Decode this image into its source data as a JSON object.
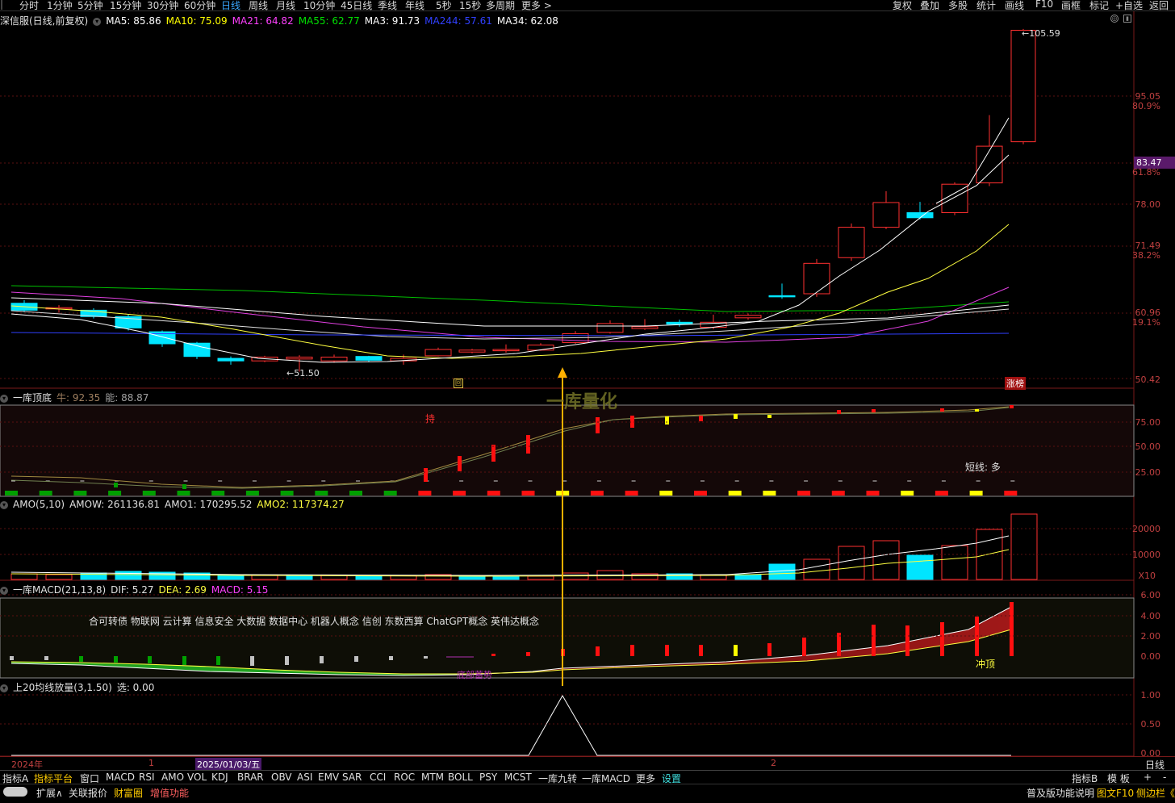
{
  "topbar": {
    "periods": [
      "分时",
      "1分钟",
      "5分钟",
      "15分钟",
      "30分钟",
      "60分钟",
      "日线",
      "周线",
      "月线",
      "10分钟",
      "45日线",
      "季线",
      "年线",
      "5秒",
      "15秒",
      "多周期",
      "更多 >"
    ],
    "selected": "日线",
    "right_tools": [
      "复权",
      "叠加",
      "多股",
      "统计",
      "画线",
      "F10",
      "画框",
      "标记",
      "+自选",
      "返回"
    ]
  },
  "main_panel": {
    "title": "深信服(日线,前复权)",
    "ma": [
      {
        "label": "MA5: 85.86",
        "color": "#ffffff"
      },
      {
        "label": "MA10: 75.09",
        "color": "#ffff00"
      },
      {
        "label": "MA21: 64.82",
        "color": "#ff40ff"
      },
      {
        "label": "MA55: 62.77",
        "color": "#00e000"
      },
      {
        "label": "MA3: 91.73",
        "color": "#ffffff"
      },
      {
        "label": "MA244: 57.61",
        "color": "#3040ff"
      },
      {
        "label": "MA34: 62.08",
        "color": "#ffffff"
      }
    ],
    "high_label": "105.59",
    "low_label": "51.50",
    "current_price": "83.47",
    "zhangbang": "涨榜",
    "y_labels": [
      "95.05",
      "80.9%",
      "78.00",
      "71.49",
      "38.2%",
      "60.96",
      "19.1%",
      "50.42",
      "61.8%"
    ]
  },
  "watermark": "一库量化",
  "panel_top_bottom": {
    "title": "一库顶底",
    "niu": "牛: 92.35",
    "neng": "能: 88.87",
    "chi": "持",
    "short": "短线: 多",
    "y_labels": [
      "75.00",
      "50.00",
      "25.00"
    ]
  },
  "panel_amo": {
    "title": "AMO(5,10)",
    "amow": "AMOW: 261136.81",
    "amo1": "AMO1: 170295.52",
    "amo2": "AMO2: 117374.27",
    "y_labels": [
      "20000",
      "10000",
      "X10"
    ]
  },
  "panel_macd": {
    "title": "一库MACD(21,13,8)",
    "dif": "DIF: 5.27",
    "dea": "DEA: 2.69",
    "macd": "MACD: 5.15",
    "concepts": "合可转债 物联网 云计算 信息安全 大数据 数据中心 机器人概念 信创 东数西算 ChatGPT概念 英伟达概念",
    "chongding": "冲顶",
    "dibu": "底部蓄势",
    "y_labels": [
      "6.00",
      "4.00",
      "2.00",
      "0.00"
    ]
  },
  "panel_vol": {
    "title": "上20均线放量(3,1.50)",
    "xuan": "选: 0.00",
    "y_labels": [
      "1.00",
      "0.50",
      "0.00"
    ]
  },
  "date_axis": {
    "year": "2024年",
    "m1": "1",
    "date": "2025/01/03/五",
    "m2": "2",
    "period": "日线"
  },
  "bottom_tabs": [
    "指标A",
    "指标平台",
    "窗口",
    "MACD",
    "RSI",
    "AMO",
    "VOL",
    "KDJ",
    "BRAR",
    "OBV",
    "ASI",
    "EMV",
    "SAR",
    "CCI",
    "ROC",
    "MTM",
    "BOLL",
    "PSY",
    "MCST",
    "一库九转",
    "一库MACD",
    "更多",
    "设置"
  ],
  "bottom_right": [
    "指标B",
    "模 板",
    "+",
    "-"
  ],
  "status_bar": {
    "left": [
      "扩展∧",
      "关联报价",
      "财富圈",
      "增值功能"
    ],
    "right": [
      "普及版功能说明",
      "图文F10",
      "侧边栏《"
    ]
  },
  "colors": {
    "up": "#ff3030",
    "down": "#00e5ff",
    "grid": "#7a1a1a",
    "accent": "#3aa8ff"
  }
}
